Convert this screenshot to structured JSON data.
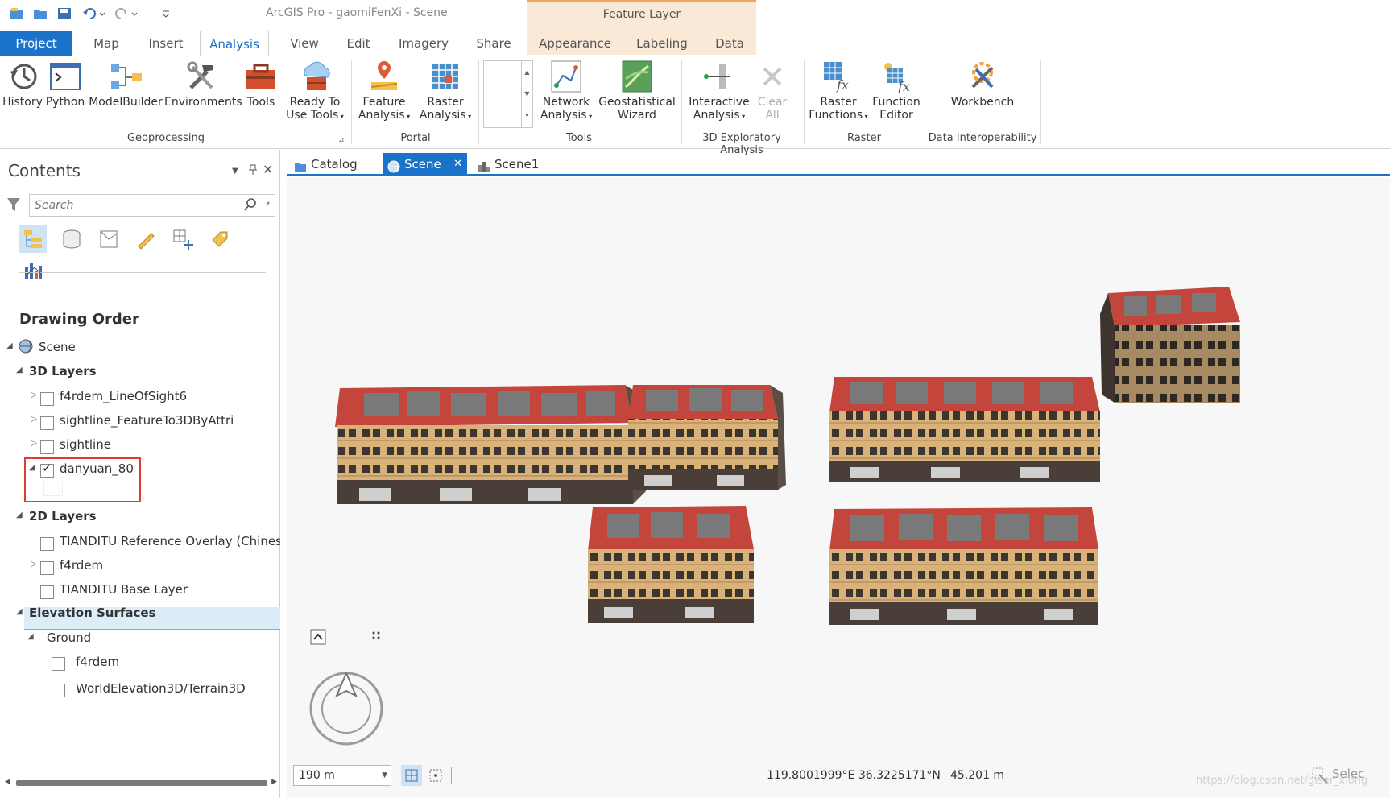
{
  "window": {
    "title": "ArcGIS Pro - gaomiFenXi - Scene",
    "context_tab_group": "Feature Layer"
  },
  "quick_access": [
    "new-project-icon",
    "open-folder-icon",
    "save-icon",
    "undo-icon",
    "redo-icon",
    "customize-icon"
  ],
  "ribbon_tabs": [
    {
      "label": "Project"
    },
    {
      "label": "Map"
    },
    {
      "label": "Insert"
    },
    {
      "label": "Analysis"
    },
    {
      "label": "View"
    },
    {
      "label": "Edit"
    },
    {
      "label": "Imagery"
    },
    {
      "label": "Share"
    },
    {
      "label": "Appearance"
    },
    {
      "label": "Labeling"
    },
    {
      "label": "Data"
    }
  ],
  "active_tab": "Analysis",
  "ribbon": {
    "geoprocessing": {
      "label": "Geoprocessing",
      "buttons": [
        {
          "label": "History"
        },
        {
          "label": "Python"
        },
        {
          "label": "ModelBuilder"
        },
        {
          "label": "Environments"
        },
        {
          "label": "Tools"
        },
        {
          "label": "Ready To",
          "label2": "Use Tools"
        }
      ]
    },
    "portal": {
      "label": "Portal",
      "buttons": [
        {
          "label": "Feature",
          "label2": "Analysis"
        },
        {
          "label": "Raster",
          "label2": "Analysis"
        }
      ]
    },
    "tools": {
      "label": "Tools",
      "buttons": [
        {
          "label": "Network",
          "label2": "Analysis"
        },
        {
          "label": "Geostatistical",
          "label2": "Wizard"
        }
      ]
    },
    "exploratory": {
      "label": "3D Exploratory Analysis",
      "buttons": [
        {
          "label": "Interactive",
          "label2": "Analysis"
        },
        {
          "label": "Clear",
          "label2": "All"
        }
      ]
    },
    "raster": {
      "label": "Raster",
      "buttons": [
        {
          "label": "Raster",
          "label2": "Functions"
        },
        {
          "label": "Function",
          "label2": "Editor"
        }
      ]
    },
    "interop": {
      "label": "Data Interoperability",
      "buttons": [
        {
          "label": "Workbench"
        }
      ]
    }
  },
  "contents": {
    "title": "Contents",
    "search_placeholder": "Search",
    "section_title": "Drawing Order",
    "tree": {
      "scene": "Scene",
      "layers3d": "3D Layers",
      "l1": "f4rdem_LineOfSight6",
      "l2": "sightline_FeatureTo3DByAttri",
      "l3": "sightline",
      "l4": "danyuan_80",
      "layers2d": "2D Layers",
      "l5": "TIANDITU Reference Overlay (Chinese",
      "l6": "f4rdem",
      "l7": "TIANDITU Base Layer",
      "elev": "Elevation Surfaces",
      "ground": "Ground",
      "e1": "f4rdem",
      "e2": "WorldElevation3D/Terrain3D"
    },
    "checked": {
      "l1": false,
      "l2": false,
      "l3": false,
      "l4": true,
      "l5": false,
      "l6": false,
      "l7": false,
      "e1": false,
      "e2": false
    }
  },
  "view_tabs": [
    {
      "label": "Catalog"
    },
    {
      "label": "Scene",
      "active": true
    },
    {
      "label": "Scene1"
    }
  ],
  "status_bar": {
    "scale": "190 m",
    "coordinates": "119.8001999°E 36.3225171°N",
    "elevation": "45.201 m",
    "selection_label": "Selec",
    "watermark": "https://blog.csdn.net/giser_xiong"
  },
  "colors": {
    "accent": "#1a72c9",
    "context_band": "#fbe9d8",
    "roof": "#c4453c",
    "roof_top": "#7a7a7a",
    "facade": "#d9b27a",
    "highlight_box": "#e53935"
  }
}
